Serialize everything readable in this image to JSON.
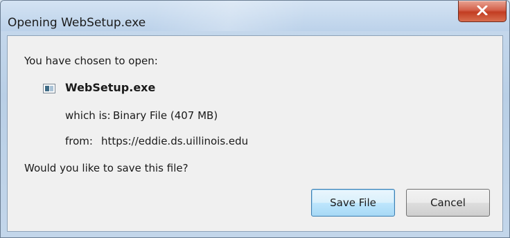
{
  "window": {
    "title": "Opening WebSetup.exe"
  },
  "dialog": {
    "intro": "You have chosen to open:",
    "file_name": "WebSetup.exe",
    "which_is_label": "which is:",
    "which_is_value": "Binary File (407 MB)",
    "from_label": "from:",
    "from_value": "https://eddie.ds.uillinois.edu",
    "question": "Would you like to save this file?"
  },
  "buttons": {
    "save_file": "Save File",
    "cancel": "Cancel"
  },
  "icons": {
    "close": "close-x-icon",
    "file": "executable-file-icon"
  },
  "colors": {
    "close_button": "#c94a30",
    "window_frame": "#bcd2ea",
    "client_background": "#f0f0f0",
    "default_button_border": "#3c7fb1"
  }
}
